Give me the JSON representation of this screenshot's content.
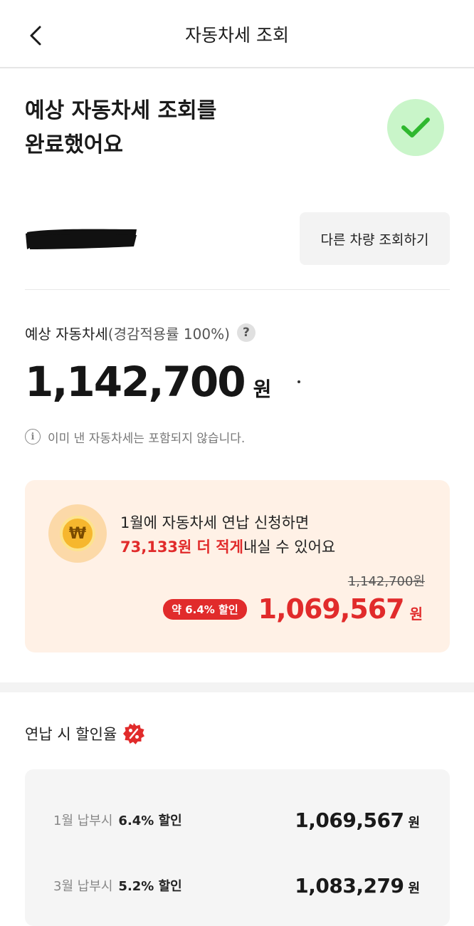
{
  "header": {
    "title": "자동차세 조회"
  },
  "result": {
    "title_line1": "예상 자동차세 조회를",
    "title_line2": "완료했어요"
  },
  "vehicle": {
    "other_vehicle_button": "다른 차량 조회하기"
  },
  "tax": {
    "label": "예상 자동차세",
    "label_detail": "(경감적용률 100%)",
    "help_symbol": "?",
    "amount": "1,142,700",
    "unit": "원",
    "notice": "이미 낸 자동차세는 포함되지 않습니다."
  },
  "promo": {
    "coin_symbol": "₩",
    "line1": "1월에 자동차세 연납 신청하면",
    "line2_highlight": "73,133원 더 적게",
    "line2_rest": "내실 수 있어요",
    "original_price": "1,142,700원",
    "discount_badge": "약 6.4% 할인",
    "discounted_price": "1,069,567",
    "unit": "원"
  },
  "rates": {
    "title": "연납 시 할인율",
    "rows": [
      {
        "month": "1월 납부시",
        "rate": "6.4% 할인",
        "amount": "1,069,567",
        "unit": "원"
      },
      {
        "month": "3월 납부시",
        "rate": "5.2% 할인",
        "amount": "1,083,279",
        "unit": "원"
      }
    ]
  },
  "colors": {
    "accent_red": "#e12b2b",
    "check_green": "#2fb82f",
    "promo_bg": "#fff1e6"
  }
}
